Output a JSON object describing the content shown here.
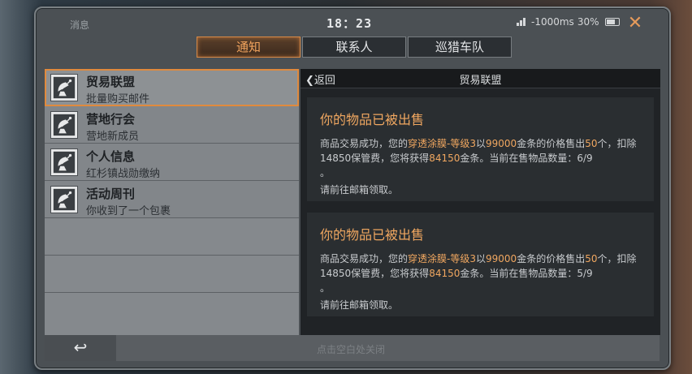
{
  "status_bar": {
    "label": "消息",
    "time": "18：23",
    "network": "-1000ms",
    "battery": "30%"
  },
  "tabs": [
    {
      "label": "通知",
      "active": true
    },
    {
      "label": "联系人",
      "active": false
    },
    {
      "label": "巡猎车队",
      "active": false
    }
  ],
  "mail_list": [
    {
      "title": "贸易联盟",
      "subtitle": "批量购买邮件",
      "selected": true
    },
    {
      "title": "营地行会",
      "subtitle": "营地新成员",
      "selected": false
    },
    {
      "title": "个人信息",
      "subtitle": "红杉镇战勋缴纳",
      "selected": false
    },
    {
      "title": "活动周刊",
      "subtitle": "你收到了一个包裹",
      "selected": false
    }
  ],
  "detail": {
    "back_label": "返回",
    "title": "贸易联盟",
    "messages": [
      {
        "title": "你的物品已被出售",
        "p1": "商品交易成功，您的",
        "item": "穿透涂膜-等级3",
        "p2": "以",
        "price": "99000",
        "p3": "金条的价格售出",
        "qty": "50",
        "p4": "个，扣除14850保管费，您将获得",
        "earn": "84150",
        "p5": "金条。当前在售物品数量：6/9",
        "p6": "。",
        "footer": "请前往邮箱领取。"
      },
      {
        "title": "你的物品已被出售",
        "p1": "商品交易成功，您的",
        "item": "穿透涂膜-等级3",
        "p2": "以",
        "price": "99000",
        "p3": "金条的价格售出",
        "qty": "50",
        "p4": "个，扣除14850保管费，您将获得",
        "earn": "84150",
        "p5": "金条。当前在售物品数量：5/9",
        "p6": "。",
        "footer": "请前往邮箱领取。"
      }
    ]
  },
  "footer": {
    "hint": "点击空白处关闭"
  },
  "colors": {
    "accent": "#f0a760",
    "tab_active_border": "#d88a47",
    "close": "#e59a5b"
  }
}
